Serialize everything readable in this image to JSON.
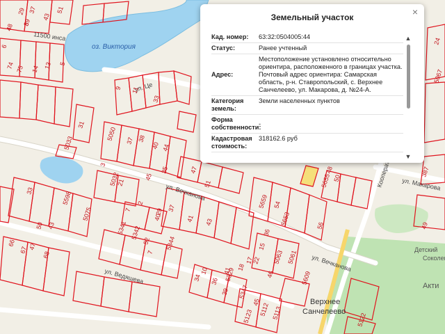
{
  "popup": {
    "title": "Земельный участок",
    "close_icon": "close-icon",
    "rows": [
      {
        "key": "Кад. номер:",
        "value": "63:32:0504005:44"
      },
      {
        "key": "Статус:",
        "value": "Ранее учтенный"
      },
      {
        "key": "Адрес:",
        "value": "Местоположение установлено относительно ориентира, расположенного в границах участка. Почтовый адрес ориентира: Самарская область, р-н. Ставропольский, с. Верхнее Санчелеево, ул. Макарова, д. №24-А."
      },
      {
        "key": "Категория земель:",
        "value": "Земли населенных пунктов"
      },
      {
        "key": "Форма собственности:",
        "value": "-"
      },
      {
        "key": "Кадастровая стоимость:",
        "value": "318162.6 руб"
      }
    ]
  },
  "map": {
    "water_name": "оз. Виктория",
    "place_name_1": "Верхнее",
    "place_name_2": "Санчелеево",
    "poi_1": "Детский",
    "poi_2": "Соколенок",
    "poi_3": "Акти",
    "streets": {
      "lenina": "11500 инса",
      "tsentr": "ул. Це",
      "vechkanova": "ул. Вечканова",
      "vechkanova2": "ул. Вечканова",
      "vedyasheva": "ул. Ведяшева",
      "makarova": "ул. Макарова",
      "kooperativnaya": "Кооператив"
    },
    "parcel_numbers": [
      "4",
      "39",
      "43",
      "51",
      "37",
      "29",
      "6",
      "14",
      "13",
      "5",
      "75",
      "74",
      "9",
      "11",
      "31",
      "33",
      "40",
      "5033",
      "5050",
      "37",
      "38",
      "44",
      "45",
      "35",
      "21",
      "47",
      "51",
      "5032",
      "3",
      "2",
      "7",
      "29",
      "37",
      "41",
      "43",
      "33",
      "5598",
      "5075",
      "5341",
      "5342",
      "52",
      "50",
      "43",
      "47",
      "66",
      "67",
      "68",
      "7",
      "40",
      "5344",
      "34",
      "36",
      "41",
      "18",
      "17",
      "5329",
      "15",
      "10",
      "22",
      "5063",
      "5659",
      "54",
      "56",
      "36",
      "5653",
      "5655",
      "50",
      "48",
      "46",
      "5061",
      "5347",
      "39",
      "45",
      "5112",
      "5113",
      "5123",
      "5609",
      "5122",
      "49",
      "387",
      "5067",
      "24",
      "48",
      "8"
    ]
  }
}
